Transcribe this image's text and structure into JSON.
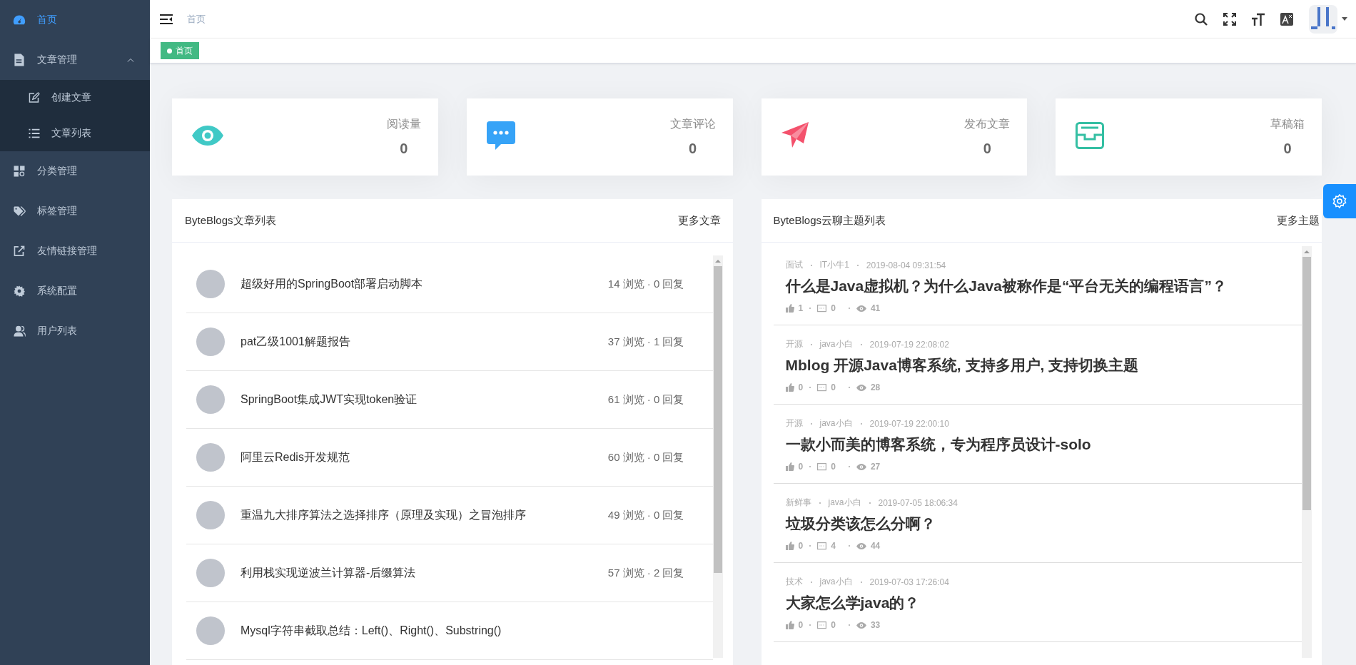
{
  "sidebar": {
    "items": [
      {
        "label": "首页",
        "selected": true
      },
      {
        "label": "文章管理",
        "selected": false,
        "expanded": true,
        "children": [
          {
            "label": "创建文章",
            "selected": false
          },
          {
            "label": "文章列表",
            "selected": false
          }
        ]
      },
      {
        "label": "分类管理",
        "selected": false
      },
      {
        "label": "标签管理",
        "selected": false
      },
      {
        "label": "友情链接管理",
        "selected": false
      },
      {
        "label": "系统配置",
        "selected": false
      },
      {
        "label": "用户列表",
        "selected": false
      }
    ]
  },
  "header": {
    "breadcrumb": "首页"
  },
  "tags": [
    {
      "label": "首页",
      "selected": true
    }
  ],
  "stats": [
    {
      "label": "阅读量",
      "value": "0",
      "color": "#40c9c6"
    },
    {
      "label": "文章评论",
      "value": "0",
      "color": "#36a3f7"
    },
    {
      "label": "发布文章",
      "value": "0",
      "color": "#f4516c"
    },
    {
      "label": "草稿箱",
      "value": "0",
      "color": "#34bfa3"
    }
  ],
  "articles": {
    "title": "ByteBlogs文章列表",
    "more": "更多文章",
    "rows": [
      {
        "title": "超级好用的SpringBoot部署启动脚本",
        "stats": "14 浏览 · 0 回复"
      },
      {
        "title": "pat乙级1001解题报告",
        "stats": "37 浏览 · 1 回复"
      },
      {
        "title": "SpringBoot集成JWT实现token验证",
        "stats": "61 浏览 · 0 回复"
      },
      {
        "title": "阿里云Redis开发规范",
        "stats": "60 浏览 · 0 回复"
      },
      {
        "title": "重温九大排序算法之选择排序（原理及实现）之冒泡排序",
        "stats": "49 浏览 · 0 回复"
      },
      {
        "title": "利用栈实现逆波兰计算器-后缀算法",
        "stats": "57 浏览 · 2 回复"
      },
      {
        "title": "Mysql字符串截取总结：Left()、Right()、Substring()"
      }
    ]
  },
  "topics": {
    "title": "ByteBlogs云聊主题列表",
    "more": "更多主题",
    "items": [
      {
        "category": "面试",
        "author": "IT小牛1",
        "time": "2019-08-04 09:31:54",
        "title": "什么是Java虚拟机？为什么Java被称作是“平台无关的编程语言”？",
        "likes": "1",
        "comments": "0",
        "views": "41"
      },
      {
        "category": "开源",
        "author": "java小白",
        "time": "2019-07-19 22:08:02",
        "title": "Mblog 开源Java博客系统, 支持多用户, 支持切换主题",
        "likes": "0",
        "comments": "0",
        "views": "28"
      },
      {
        "category": "开源",
        "author": "java小白",
        "time": "2019-07-19 22:00:10",
        "title": "一款小而美的博客系统，专为程序员设计-solo",
        "likes": "0",
        "comments": "0",
        "views": "27"
      },
      {
        "category": "新鲜事",
        "author": "java小白",
        "time": "2019-07-05 18:06:34",
        "title": "垃圾分类该怎么分啊？",
        "likes": "0",
        "comments": "4",
        "views": "44"
      },
      {
        "category": "技术",
        "author": "java小白",
        "time": "2019-07-03 17:26:04",
        "title": "大家怎么学java的？",
        "likes": "0",
        "comments": "0",
        "views": "33"
      }
    ]
  }
}
